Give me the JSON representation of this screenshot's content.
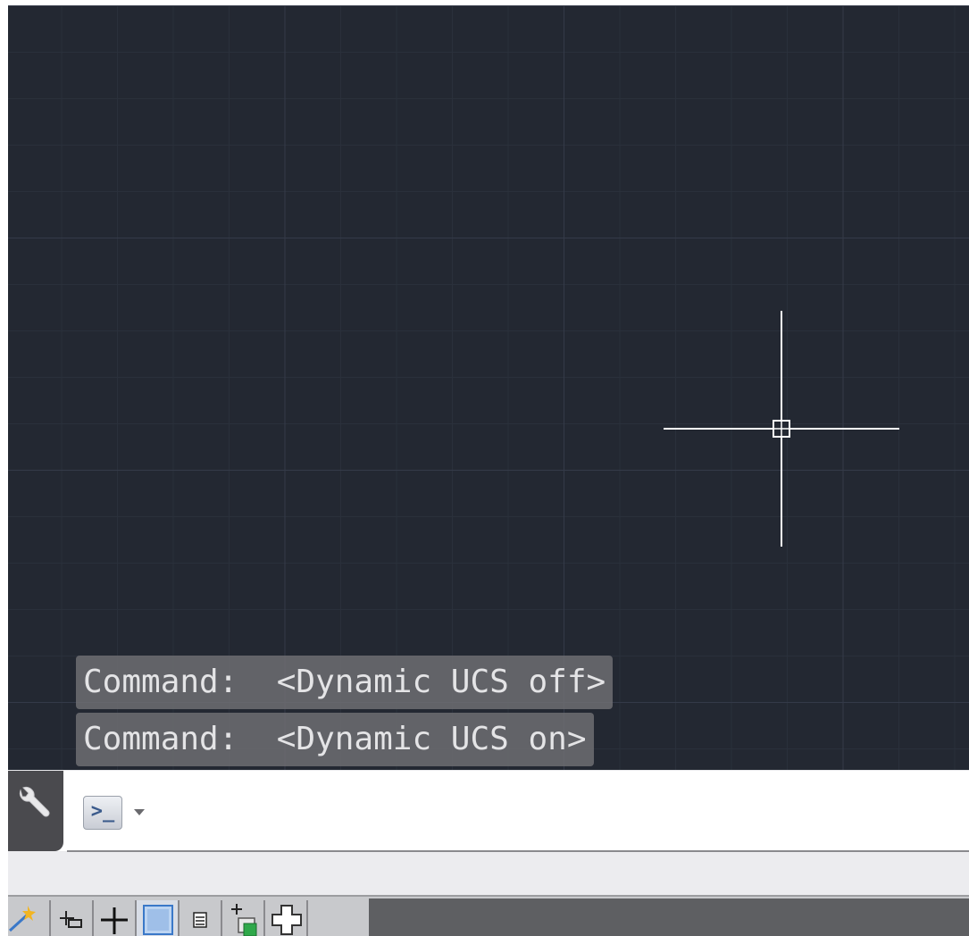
{
  "command_history": [
    "Command:  <Dynamic UCS off>",
    "Command:  <Dynamic UCS on>"
  ],
  "command_line": {
    "value": "",
    "placeholder": "",
    "icons": [
      "wrench-icon",
      "command-prompt-icon",
      "dropdown-arrow-icon"
    ]
  },
  "status_bar": {
    "buttons": [
      "annotation-magic-icon",
      "ortho-mode-icon",
      "infer-constraints-icon",
      "transparency-icon",
      "selection-cycling-icon",
      "dynamic-ucs-icon",
      "snap-crosshair-icon"
    ]
  },
  "colors": {
    "canvas_bg": "#232832",
    "grid_major": "#343a48",
    "grid_minor": "#2a303b",
    "history_bg": "#707074",
    "history_text": "#e4e4e6",
    "crosshair": "#ffffff"
  }
}
